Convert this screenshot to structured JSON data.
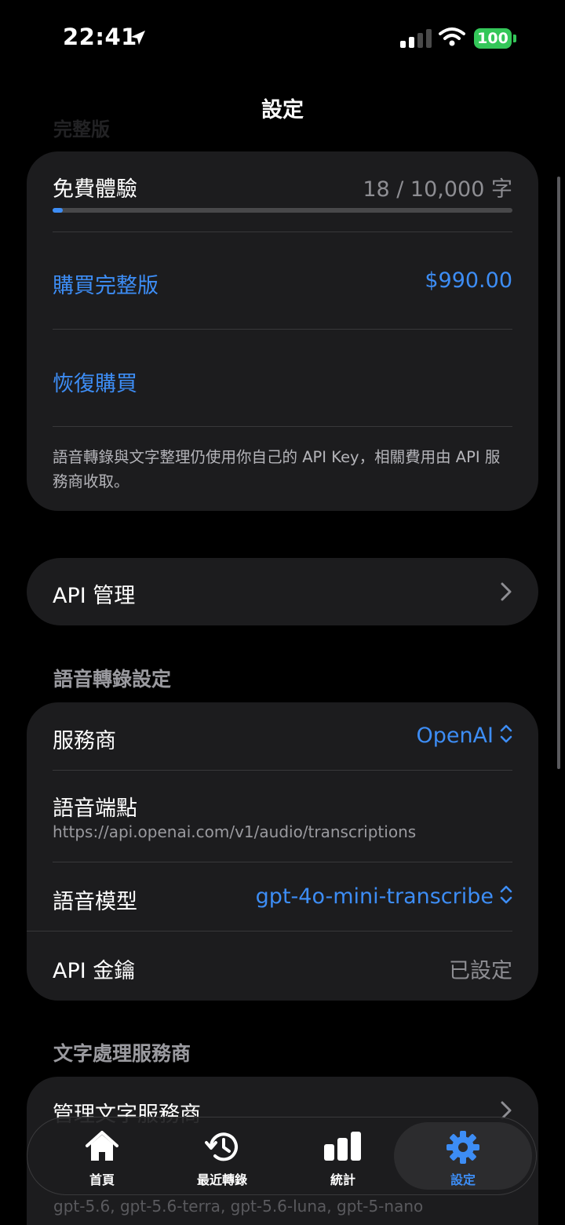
{
  "status_bar": {
    "time": "22:41",
    "battery": "100"
  },
  "nav": {
    "title": "設定"
  },
  "faded_section_header": "完整版",
  "plan_card": {
    "trial_label": "免費體驗",
    "usage": "18 / 10,000 字",
    "usage_progress": 0.0018,
    "buy_label": "購買完整版",
    "price": "$990.00",
    "restore_label": "恢復購買",
    "note": "語音轉錄與文字整理仍使用你自己的 API Key，相關費用由 API 服務商收取。"
  },
  "api_card": {
    "label": "API 管理"
  },
  "speech_section": {
    "header": "語音轉錄設定",
    "provider_label": "服務商",
    "provider_value": "OpenAI",
    "endpoint_label": "語音端點",
    "endpoint_value": "https://api.openai.com/v1/audio/transcriptions",
    "model_label": "語音模型",
    "model_value": "gpt-4o-mini-transcribe",
    "key_label": "API 金鑰",
    "key_value": "已設定"
  },
  "text_section": {
    "header": "文字處理服務商",
    "manage_label": "管理文字服務商",
    "models_behind": "gpt-5.6, gpt-5.6-terra, gpt-5.6-luna, gpt-5-nano"
  },
  "tabs": [
    {
      "label": "首頁",
      "icon": "house-icon",
      "active": false
    },
    {
      "label": "最近轉錄",
      "icon": "history-icon",
      "active": false
    },
    {
      "label": "統計",
      "icon": "chart-bar-icon",
      "active": false
    },
    {
      "label": "設定",
      "icon": "gear-icon",
      "active": true
    }
  ],
  "colors": {
    "accent": "#3d8df5",
    "card": "#1c1c1e",
    "battery": "#34c759"
  }
}
